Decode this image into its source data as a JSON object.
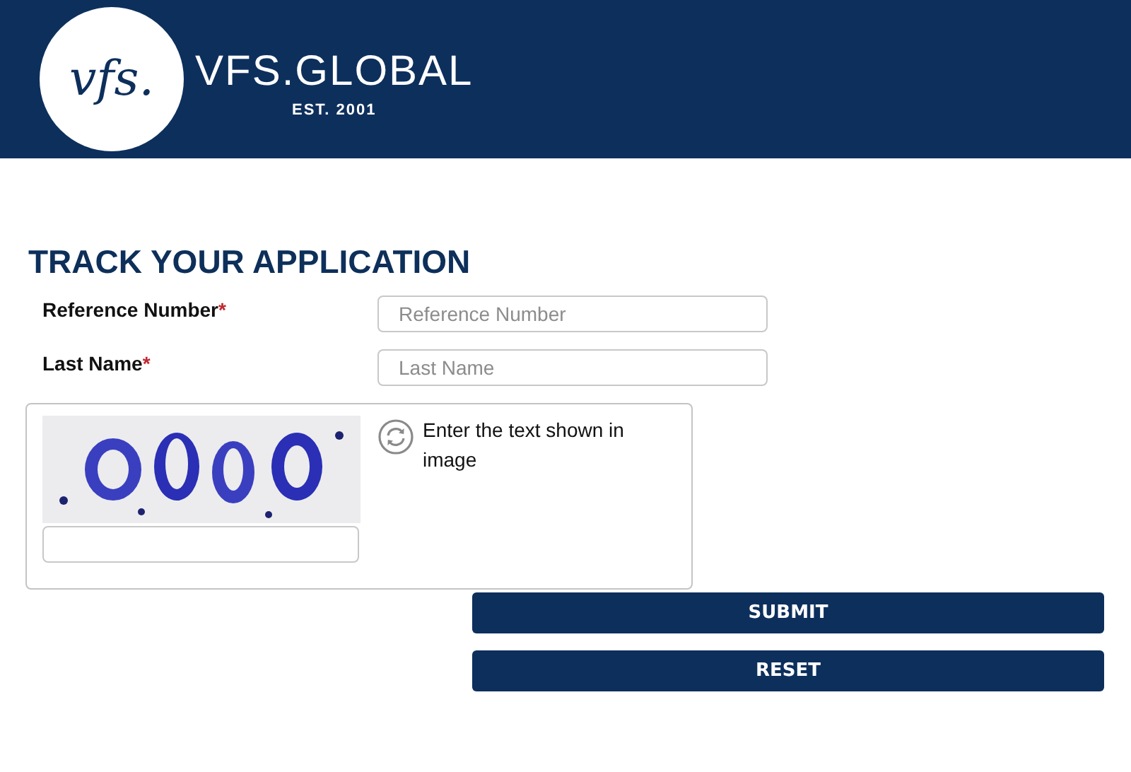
{
  "header": {
    "logo_mark": "vfs.",
    "brand": "VFS.GLOBAL",
    "tagline": "EST. 2001"
  },
  "title": "TRACK YOUR APPLICATION",
  "fields": [
    {
      "label": "Reference Number",
      "required_mark": "*",
      "placeholder": "Reference Number"
    },
    {
      "label": "Last Name",
      "required_mark": "*",
      "placeholder": "Last Name"
    }
  ],
  "captcha": {
    "instruction": "Enter the text shown in image"
  },
  "buttons": [
    "SUBMIT",
    "RESET"
  ]
}
